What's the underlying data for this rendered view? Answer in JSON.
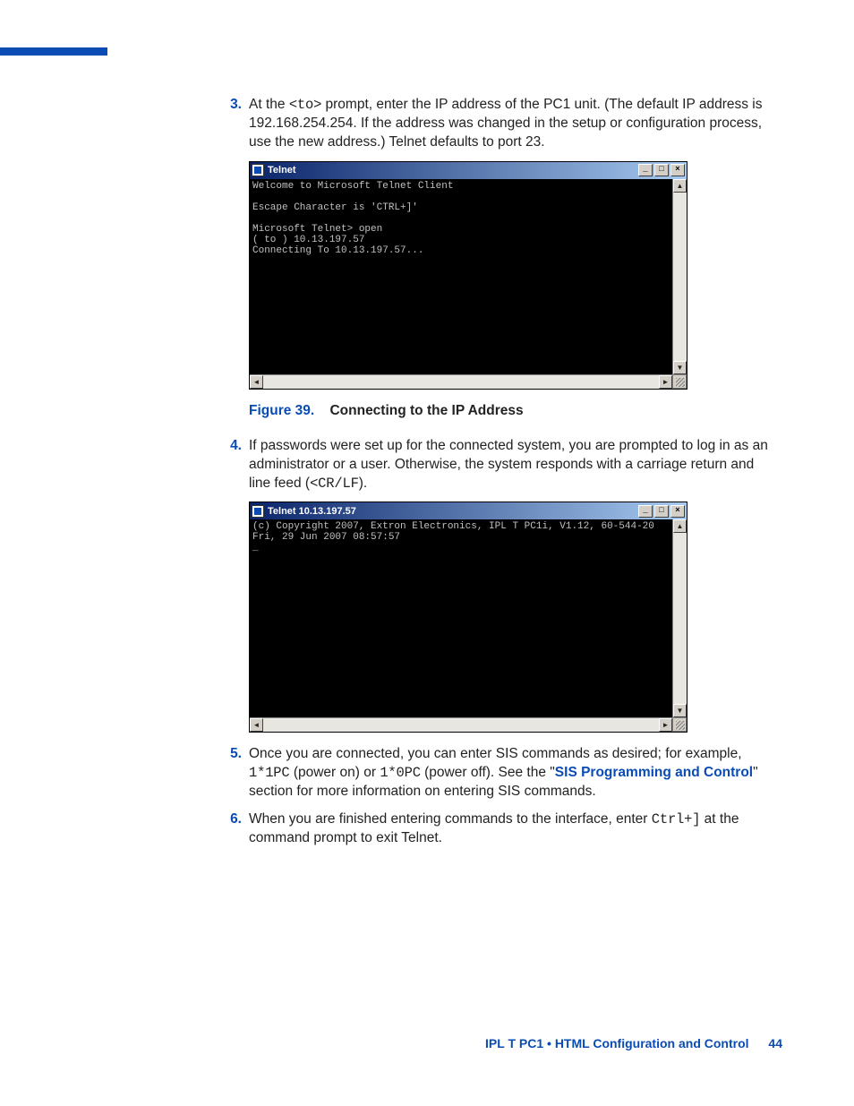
{
  "step3": {
    "num": "3.",
    "t1": "At the ",
    "code1": "<to>",
    "t2": " prompt, enter the IP address of the PC1 unit. (The default IP address is 192.168.254.254. If the address was changed in the setup or configuration process, use the new address.) Telnet defaults to port 23."
  },
  "win1": {
    "title": "Telnet",
    "btn_min": "_",
    "btn_max": "□",
    "btn_close": "×",
    "up": "▲",
    "down": "▼",
    "left": "◄",
    "right": "►",
    "body": "Welcome to Microsoft Telnet Client\n\nEscape Character is 'CTRL+]'\n\nMicrosoft Telnet> open\n( to ) 10.13.197.57\nConnecting To 10.13.197.57..."
  },
  "caption1": {
    "fig": "Figure 39.",
    "txt": "Connecting to the IP Address"
  },
  "step4": {
    "num": "4.",
    "t1": "If passwords were set up for the connected system, you are prompted to log in as an administrator or a user. Otherwise, the system responds with a carriage return and line feed (",
    "code1": "<CR/LF",
    "t2": ")."
  },
  "win2": {
    "title": "Telnet 10.13.197.57",
    "btn_min": "_",
    "btn_max": "□",
    "btn_close": "×",
    "up": "▲",
    "down": "▼",
    "left": "◄",
    "right": "►",
    "body": "(c) Copyright 2007, Extron Electronics, IPL T PC1i, V1.12, 60-544-20\nFri, 29 Jun 2007 08:57:57\n_"
  },
  "step5": {
    "num": "5.",
    "t1": "Once you are connected, you can enter SIS commands as desired; for example, ",
    "code1": "1*1PC",
    "t2": " (power on) or ",
    "code2": "1*0PC",
    "t3": " (power off). See the \"",
    "link": "SIS Programming and Control",
    "t4": "\" section for more information on entering SIS commands."
  },
  "step6": {
    "num": "6.",
    "t1": "When you are finished entering commands to the interface, enter ",
    "code1": "Ctrl+]",
    "t2": " at the command prompt to exit Telnet."
  },
  "footer": {
    "txt": "IPL T PC1 • HTML Configuration and Control",
    "page": "44"
  }
}
